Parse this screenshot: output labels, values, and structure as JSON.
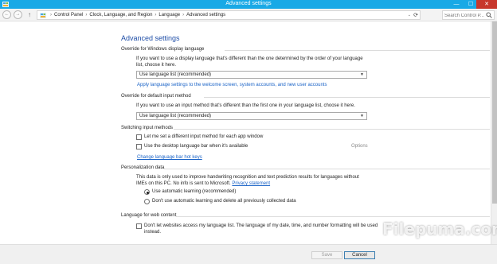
{
  "window": {
    "title": "Advanced settings",
    "min": "—",
    "max": "☐",
    "close": "✕"
  },
  "address": {
    "back": "←",
    "forward": "→",
    "up": "↑",
    "crumbs": [
      "Control Panel",
      "Clock, Language, and Region",
      "Language",
      "Advanced settings"
    ],
    "separator": "›",
    "dropdown": "⌄",
    "refresh": "⟳",
    "search_placeholder": "Search Control P..."
  },
  "page": {
    "title": "Advanced settings"
  },
  "display_language": {
    "heading": "Override for Windows display language",
    "description": "If you want to use a display language that's different than the one determined by the order of your language list, choose it here.",
    "selected": "Use language list (recommended)",
    "apply_link": "Apply language settings to the welcome screen, system accounts, and new user accounts"
  },
  "input_method": {
    "heading": "Override for default input method",
    "description": "If you want to use an input method that's different than the first one in your language list, choose it here.",
    "selected": "Use language list (recommended)"
  },
  "switching": {
    "heading": "Switching input methods",
    "option1": "Let me set a different input method for each app window",
    "option2": "Use the desktop language bar when it's available",
    "options_link": "Options",
    "hotkeys_link": "Change language bar hot keys"
  },
  "personalization": {
    "heading": "Personalization data",
    "description": "This data is only used to improve handwriting recognition and text prediction results for languages without IMEs on this PC. No info is sent to Microsoft.",
    "privacy_link": "Privacy statement",
    "radio1": "Use automatic learning (recommended)",
    "radio2": "Don't use automatic learning and delete all previously collected data",
    "selected_radio": 1
  },
  "web_content": {
    "heading": "Language for web content",
    "option": "Don't let websites access my language list. The language of my date, time, and number formatting will be used instead."
  },
  "footer": {
    "save": "Save",
    "cancel": "Cancel"
  },
  "watermark": "Filepuma.com",
  "colors": {
    "titlebar": "#19a9e6",
    "link": "#1a63c7",
    "heading": "#1f4ea7"
  }
}
